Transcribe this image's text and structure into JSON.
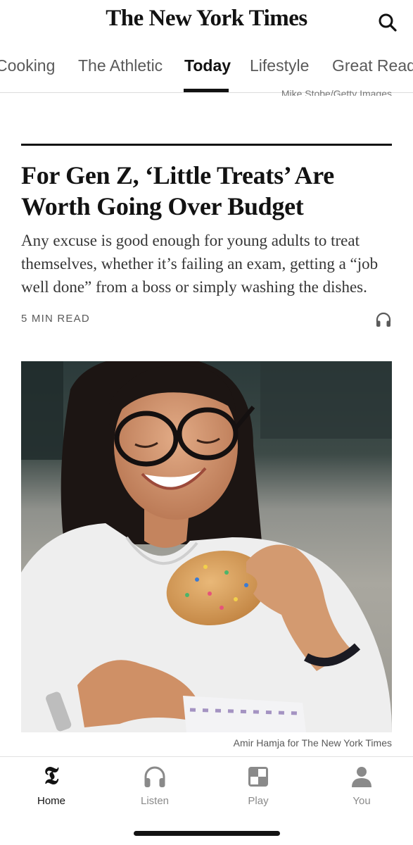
{
  "header": {
    "masthead": "The New York Times",
    "search_icon": "search-icon"
  },
  "tabs": [
    {
      "label": "Cooking",
      "active": false
    },
    {
      "label": "The Athletic",
      "active": false
    },
    {
      "label": "Today",
      "active": true
    },
    {
      "label": "Lifestyle",
      "active": false
    },
    {
      "label": "Great Read",
      "active": false
    }
  ],
  "previous_story": {
    "photo_credit": "Mike Stobe/Getty Images"
  },
  "article": {
    "headline": "For Gen Z, ‘Little Treats’ Are Worth Going Over Budget",
    "summary": "Any excuse is good enough for young adults to treat themselves, whether it’s failing an exam, getting a “job well done” from a boss or simply washing the dishes.",
    "read_time": "5 MIN READ",
    "listen_icon": "headphones-icon",
    "photo_credit": "Amir Hamja for The New York Times"
  },
  "bottom_nav": [
    {
      "label": "Home",
      "icon": "nyt-logo-icon",
      "active": true
    },
    {
      "label": "Listen",
      "icon": "headphones-icon",
      "active": false
    },
    {
      "label": "Play",
      "icon": "games-icon",
      "active": false
    },
    {
      "label": "You",
      "icon": "person-icon",
      "active": false
    }
  ],
  "colors": {
    "text": "#121212",
    "muted": "#5a5a5a",
    "nav_inactive": "#8a8a8a"
  }
}
